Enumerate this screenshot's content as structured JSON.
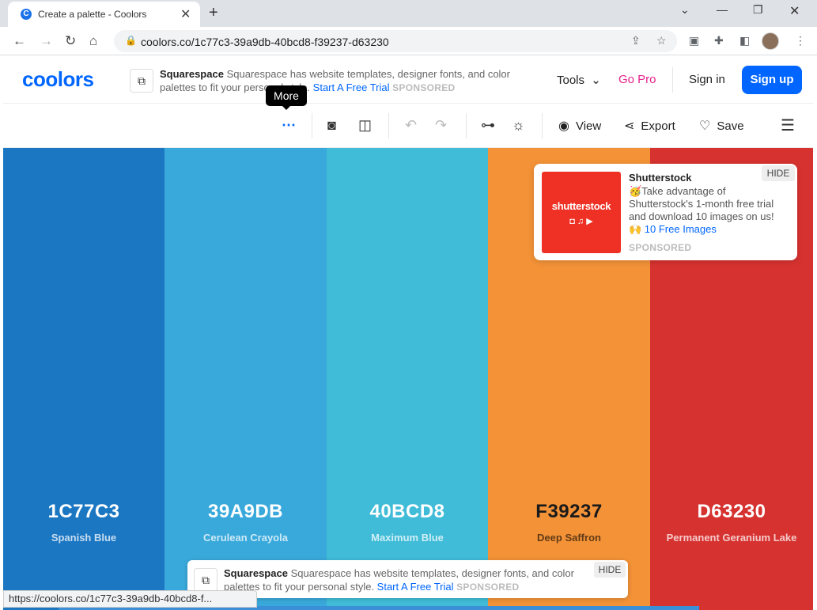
{
  "browser": {
    "tab_title": "Create a palette - Coolors",
    "favicon_letter": "C",
    "tab_close": "✕",
    "new_tab": "+",
    "url": "coolors.co/1c77c3-39a9db-40bcd8-f39237-d63230",
    "status_url": "https://coolors.co/1c77c3-39a9db-40bcd8-f...",
    "window_controls": [
      "chevron-down",
      "minimize",
      "restore",
      "close"
    ]
  },
  "header": {
    "logo": "coolors",
    "ad": {
      "brand": "Squarespace",
      "text": "Squarespace has website templates, designer fonts, and color palettes to fit your personal style.",
      "cta": "Start A Free Trial",
      "sponsored": "SPONSORED"
    },
    "tools": "Tools",
    "go_pro": "Go Pro",
    "sign_in": "Sign in",
    "sign_up": "Sign up"
  },
  "toolbar": {
    "tooltip": "More",
    "view": "View",
    "export": "Export",
    "save": "Save"
  },
  "palette": [
    {
      "hex": "1C77C3",
      "name": "Spanish Blue",
      "color": "#1c77c3",
      "text_color": "#ffffff",
      "name_color": "rgba(255,255,255,0.75)"
    },
    {
      "hex": "39A9DB",
      "name": "Cerulean Crayola",
      "color": "#39a9db",
      "text_color": "#ffffff",
      "name_color": "rgba(255,255,255,0.75)"
    },
    {
      "hex": "40BCD8",
      "name": "Maximum Blue",
      "color": "#40bcd8",
      "text_color": "#ffffff",
      "name_color": "rgba(255,255,255,0.75)"
    },
    {
      "hex": "F39237",
      "name": "Deep Saffron",
      "color": "#f39237",
      "text_color": "#1a1a1a",
      "name_color": "rgba(0,0,0,0.6)"
    },
    {
      "hex": "D63230",
      "name": "Permanent Geranium Lake",
      "color": "#d63230",
      "text_color": "#ffffff",
      "name_color": "rgba(255,255,255,0.75)"
    }
  ],
  "shutterstock_ad": {
    "title": "Shutterstock",
    "image_text": "shutterstock",
    "body": "🥳Take advantage of Shutterstock's 1-month free trial and download 10 images on us!",
    "link": "🙌 10 Free Images",
    "sponsored": "SPONSORED",
    "hide": "HIDE"
  },
  "bottom_ad": {
    "brand": "Squarespace",
    "text": "Squarespace has website templates, designer fonts, and color palettes to fit your personal style.",
    "cta": "Start A Free Trial",
    "sponsored": "SPONSORED",
    "hide": "HIDE"
  }
}
